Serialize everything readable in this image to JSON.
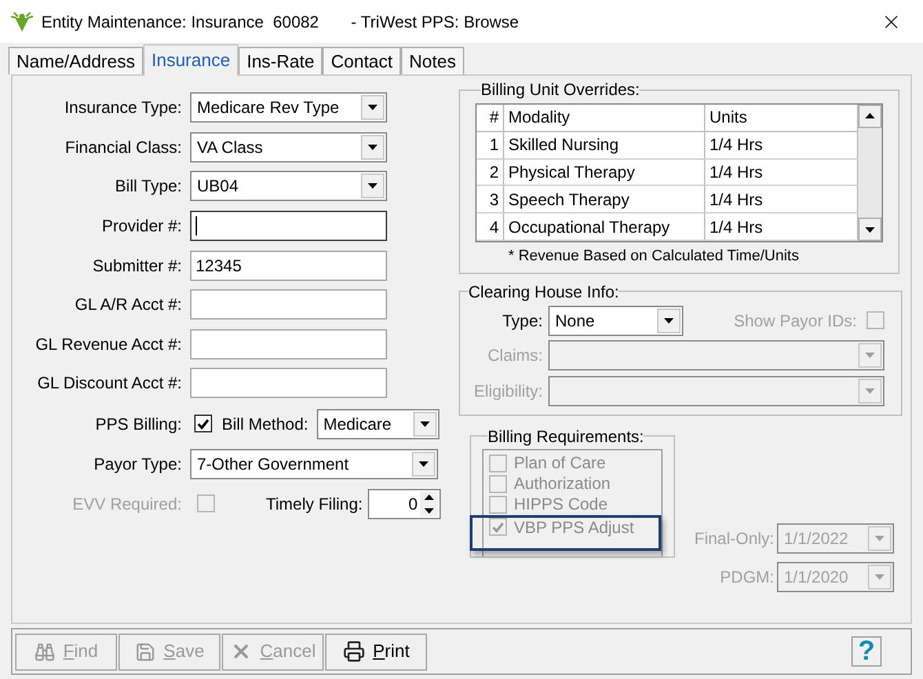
{
  "window": {
    "title": "Entity Maintenance: Insurance  60082       - TriWest PPS: Browse"
  },
  "tabs": [
    {
      "label": "Name/Address",
      "selected": false
    },
    {
      "label": "Insurance",
      "selected": true
    },
    {
      "label": "Ins-Rate",
      "selected": false
    },
    {
      "label": "Contact",
      "selected": false
    },
    {
      "label": "Notes",
      "selected": false
    }
  ],
  "fields": [
    {
      "label": "Insurance Type:",
      "kind": "select",
      "value": "Medicare Rev Type"
    },
    {
      "label": "Financial Class:",
      "kind": "select",
      "value": "VA Class"
    },
    {
      "label": "Bill Type:",
      "kind": "select",
      "value": "UB04"
    },
    {
      "label": "Provider #:",
      "kind": "text",
      "focused": true
    },
    {
      "label": "Submitter #:",
      "kind": "text",
      "value": "12345",
      "focused": false
    },
    {
      "label": "GL A/R Acct #:",
      "kind": "text",
      "focused": false
    },
    {
      "label": "GL Revenue Acct #:",
      "kind": "text",
      "focused": false
    },
    {
      "label": "GL Discount Acct #:",
      "kind": "text",
      "focused": false
    }
  ],
  "pps_billing": {
    "label": "PPS Billing:",
    "checked": true
  },
  "bill_method": {
    "label": "Bill Method:",
    "value": "Medicare"
  },
  "payor_type": {
    "label": "Payor Type:",
    "value": "7-Other Government"
  },
  "evv_required": {
    "label": "EVV Required:",
    "checked": false,
    "disabled": true
  },
  "timely_filing": {
    "label": "Timely Filing:",
    "value": "0"
  },
  "billing_unit_overrides": {
    "title": "Billing Unit Overrides:",
    "columns": [
      "#",
      "Modality",
      "Units"
    ],
    "rows": [
      [
        "1",
        "Skilled Nursing",
        "1/4 Hrs"
      ],
      [
        "2",
        "Physical Therapy",
        "1/4 Hrs"
      ],
      [
        "3",
        "Speech Therapy",
        "1/4 Hrs"
      ],
      [
        "4",
        "Occupational Therapy",
        "1/4 Hrs"
      ]
    ],
    "note": "* Revenue Based on Calculated Time/Units"
  },
  "clearing_house": {
    "title": "Clearing House Info:",
    "type": {
      "label": "Type:",
      "value": "None"
    },
    "show_payor_ids": {
      "label": "Show Payor IDs:",
      "checked": false,
      "disabled": true
    },
    "claims": {
      "label": "Claims:",
      "disabled": true
    },
    "eligibility": {
      "label": "Eligibility:",
      "disabled": true
    }
  },
  "billing_requirements": {
    "title": "Billing Requirements:",
    "items": [
      {
        "label": "Plan of Care",
        "checked": false,
        "highlighted": false
      },
      {
        "label": "Authorization",
        "checked": false,
        "highlighted": false
      },
      {
        "label": "HIPPS Code",
        "checked": false,
        "highlighted": false
      },
      {
        "label": "VBP PPS Adjust",
        "checked": true,
        "highlighted": true
      }
    ],
    "disabled": true
  },
  "final_only": {
    "label": "Final-Only:",
    "value": "1/1/2022",
    "disabled": true
  },
  "pdgm": {
    "label": "PDGM:",
    "value": "1/1/2020",
    "disabled": true
  },
  "toolbar": {
    "buttons": [
      {
        "kind": "find",
        "label": "Find",
        "disabled": true
      },
      {
        "kind": "save",
        "label": "Save",
        "disabled": true
      },
      {
        "kind": "cancel",
        "label": "Cancel",
        "disabled": true
      },
      {
        "kind": "print",
        "label": "Print",
        "disabled": false
      }
    ],
    "help": "?"
  }
}
